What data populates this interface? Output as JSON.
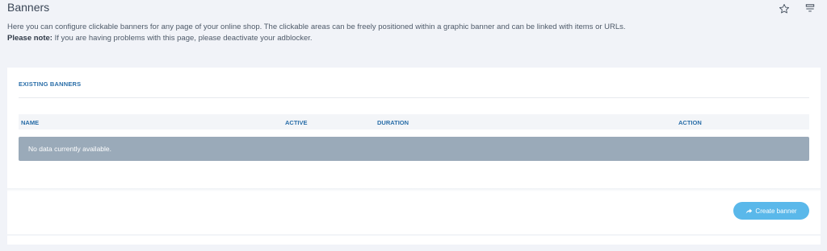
{
  "page": {
    "title": "Banners",
    "description": "Here you can configure clickable banners for any page of your online shop. The clickable areas can be freely positioned within a graphic banner and can be linked with items or URLs.",
    "note_label": "Please note:",
    "note_text": " If you are having problems with this page, please deactivate your adblocker."
  },
  "header_icons": [
    "star-icon",
    "menu-icon"
  ],
  "section": {
    "title": "EXISTING BANNERS",
    "columns": [
      "NAME",
      "ACTIVE",
      "DURATION",
      "ACTION"
    ],
    "empty_text": "No data currently available."
  },
  "actions": {
    "create_label": "Create banner"
  },
  "colors": {
    "accent": "#2a6ea8",
    "button": "#5ab8ea",
    "empty_row": "#9aaab9",
    "background": "#f1f3f8"
  }
}
